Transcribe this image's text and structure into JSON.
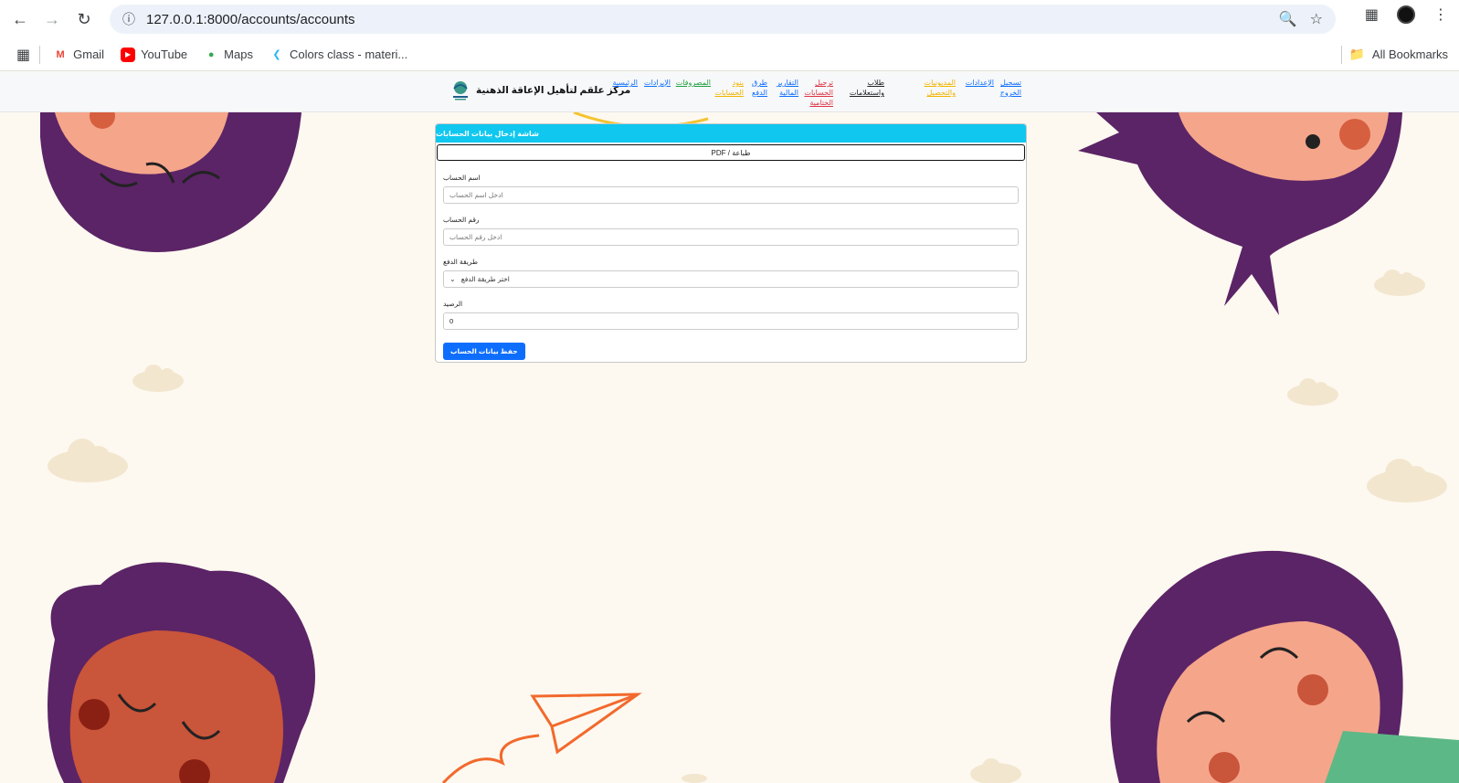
{
  "browser": {
    "url": "127.0.0.1:8000/accounts/accounts",
    "bookmarks": [
      {
        "label": "Gmail",
        "icon": "gmail-icon",
        "color": "#ea4335"
      },
      {
        "label": "YouTube",
        "icon": "youtube-icon",
        "color": "#ff0000"
      },
      {
        "label": "Maps",
        "icon": "maps-pin-icon",
        "color": "#34a853"
      },
      {
        "label": "Colors class - materi...",
        "icon": "flutter-icon",
        "color": "#29b6f6"
      }
    ],
    "all_bookmarks": "All Bookmarks"
  },
  "navbar": {
    "brand": "مركز علقم لتأهيل الإعاقة الذهنية",
    "links": [
      {
        "label": "تسجيل الخروج",
        "color": "#0d6efd"
      },
      {
        "label": "الإعدادات",
        "color": "#0d6efd"
      },
      {
        "label": "المديونيات والتحصيل",
        "color": "#f0b400"
      },
      {
        "label": "طلاب واستعلامات",
        "color": "#222222"
      },
      {
        "label": "ترحيل الحسابات الختامية",
        "color": "#dc3545"
      },
      {
        "label": "التقارير المالية",
        "color": "#0d6efd"
      },
      {
        "label": "طرق الدفع",
        "color": "#0d6efd"
      },
      {
        "label": "بنود الحسابات",
        "color": "#f0b400"
      },
      {
        "label": "المصروفات",
        "color": "#20a040"
      },
      {
        "label": "الإيرادات",
        "color": "#0d6efd"
      },
      {
        "label": "الرئيسية",
        "color": "#0d6efd"
      }
    ]
  },
  "card": {
    "header": "شاشة إدخال بيانات الحسابات",
    "print_label": "PDF / طباعة",
    "fields": [
      {
        "label": "اسم الحساب",
        "placeholder": "ادخل اسم الحساب"
      },
      {
        "label": "رقم الحساب",
        "placeholder": "ادخل رقم الحساب"
      },
      {
        "label": "طريقة الدفع",
        "placeholder": "اختر طريقة الدفع"
      },
      {
        "label": "الرصيد",
        "value": "0"
      }
    ],
    "save_label": "حفظ بيانات الحساب"
  },
  "colors": {
    "accent_header": "#10c7ef",
    "primary_button": "#0d6efd",
    "page_bg": "#fdf9f0",
    "hair_purple": "#5b2466",
    "skin": "#f5a58a"
  }
}
